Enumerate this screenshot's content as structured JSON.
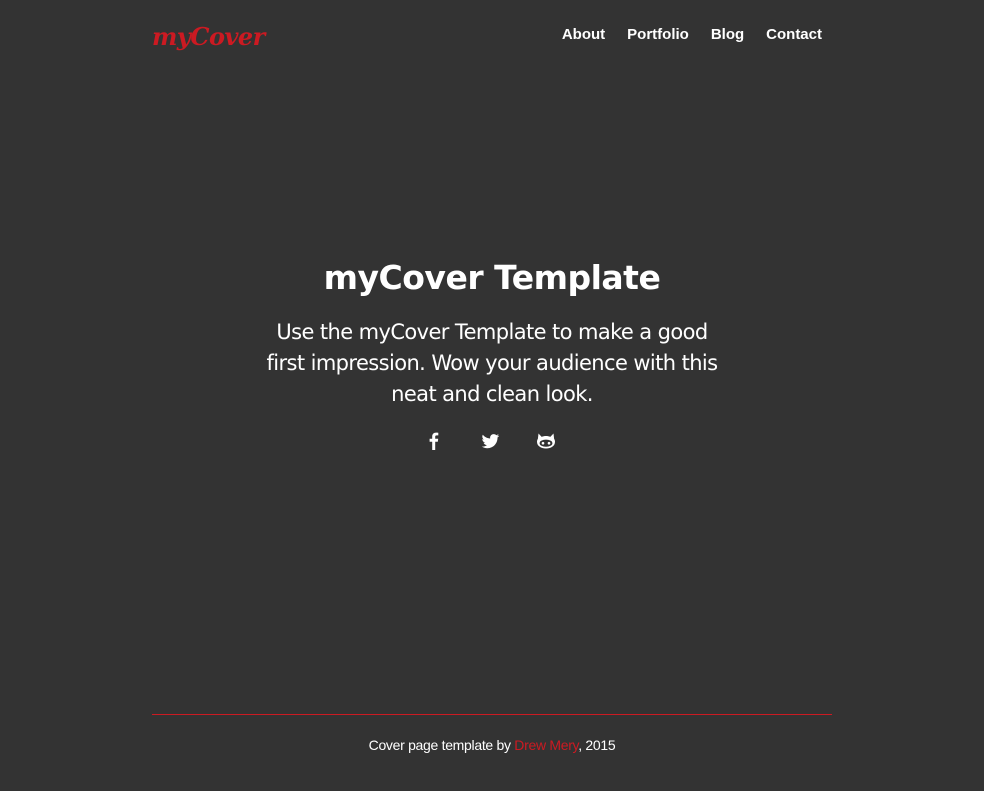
{
  "header": {
    "brand": "myCover",
    "nav": [
      "About",
      "Portfolio",
      "Blog",
      "Contact"
    ]
  },
  "main": {
    "title": "myCover Template",
    "lead": "Use the myCover Template to make a good first impression. Wow your audience with this neat and clean look.",
    "social": [
      {
        "icon": "facebook-icon"
      },
      {
        "icon": "twitter-icon"
      },
      {
        "icon": "github-icon"
      }
    ]
  },
  "footer": {
    "text_before": "Cover page template by ",
    "author": "Drew Mery",
    "text_after": ", 2015"
  },
  "colors": {
    "background": "#333333",
    "accent": "#cc1a22",
    "text": "#ffffff"
  }
}
